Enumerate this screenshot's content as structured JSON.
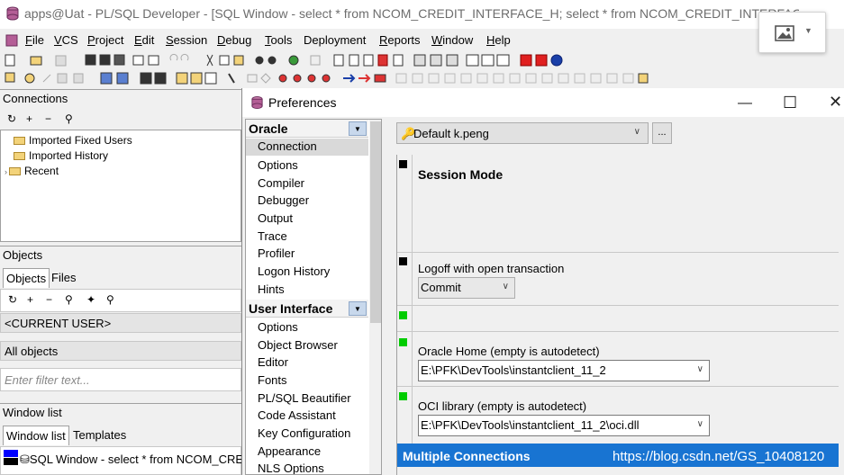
{
  "window": {
    "title": "apps@Uat - PL/SQL Developer - [SQL Window - select * from NCOM_CREDIT_INTERFACE_H; select * from NCOM_CREDIT_INTERFACE_H"
  },
  "menu": [
    {
      "u": "F",
      "rest": "ile"
    },
    {
      "u": "V",
      "rest": "CS"
    },
    {
      "u": "P",
      "rest": "roject"
    },
    {
      "u": "E",
      "rest": "dit"
    },
    {
      "u": "S",
      "rest": "ession"
    },
    {
      "u": "D",
      "rest": "ebug"
    },
    {
      "u": "T",
      "rest": "ools"
    },
    {
      "u": "",
      "rest": "Deployment"
    },
    {
      "u": "R",
      "rest": "eports"
    },
    {
      "u": "W",
      "rest": "indow"
    },
    {
      "u": "H",
      "rest": "elp"
    }
  ],
  "connections": {
    "header": "Connections",
    "tree": [
      "Imported Fixed Users",
      "Imported History",
      "Recent"
    ]
  },
  "objects": {
    "header": "Objects",
    "tabs": [
      "Objects",
      "Files"
    ],
    "current_user": "<CURRENT USER>",
    "all_objects": "All objects",
    "filter_placeholder": "Enter filter text..."
  },
  "window_list": {
    "header": "Window list",
    "tabs": [
      "Window list",
      "Templates"
    ],
    "item": "SQL Window - select * from NCOM_CREDI"
  },
  "preferences": {
    "title": "Preferences",
    "groups": [
      {
        "name": "Oracle",
        "items": [
          "Connection",
          "Options",
          "Compiler",
          "Debugger",
          "Output",
          "Trace",
          "Profiler",
          "Logon History",
          "Hints"
        ]
      },
      {
        "name": "User Interface",
        "items": [
          "Options",
          "Object Browser",
          "Editor",
          "Fonts",
          "PL/SQL Beautifier",
          "Code Assistant",
          "Key Configuration",
          "Appearance",
          "NLS Options"
        ]
      }
    ],
    "selected_item": "Connection",
    "user_profile": "Default k.peng",
    "dots_label": "...",
    "session_mode": "Session Mode",
    "logoff_label": "Logoff with open transaction",
    "logoff_value": "Commit",
    "oracle_home_label": "Oracle Home (empty is autodetect)",
    "oracle_home_value": "E:\\PFK\\DevTools\\instantclient_11_2",
    "oci_label": "OCI library (empty is autodetect)",
    "oci_value": "E:\\PFK\\DevTools\\instantclient_11_2\\oci.dll",
    "multiple_connections": "Multiple Connections",
    "watermark": "https://blog.csdn.net/GS_10408120"
  },
  "colors": {
    "accent": "#1874d2",
    "status_green": "#00cc00",
    "status_black": "#000000"
  }
}
